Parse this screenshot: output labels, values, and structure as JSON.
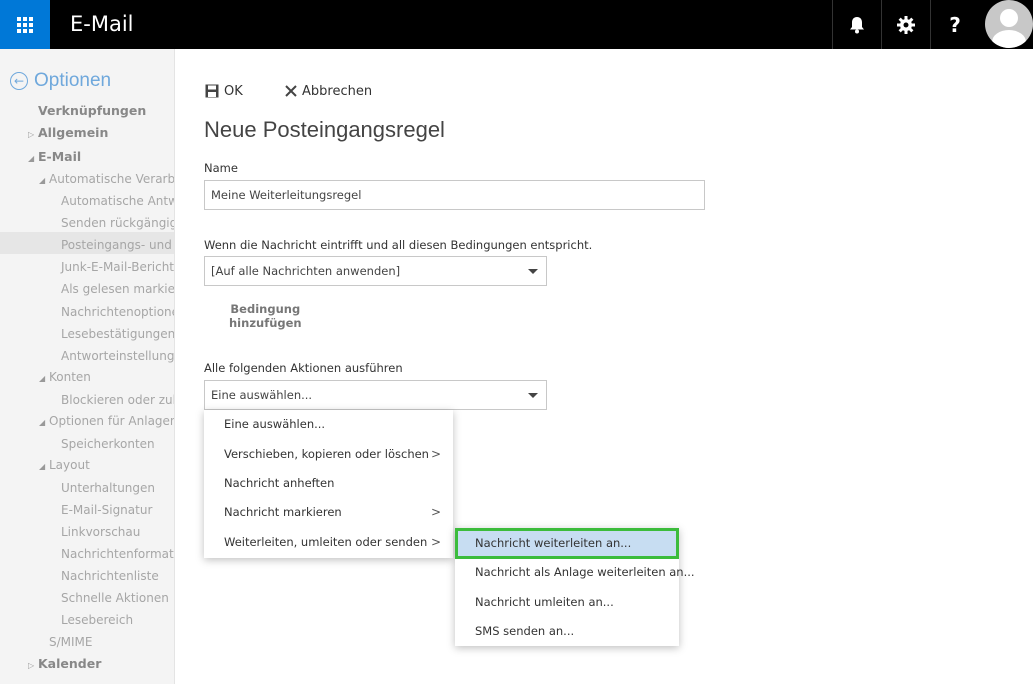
{
  "header": {
    "app_title": "E-Mail"
  },
  "sidebar": {
    "back_label": "Optionen",
    "items": [
      "Verknüpfungen",
      "Allgemein",
      "E-Mail",
      "Automatische Verarbeitung",
      "Automatische Antworten",
      "Senden rückgängig machen",
      "Posteingangs- und Aufräumregeln",
      "Junk-E-Mail-Berichterstattung",
      "Als gelesen markieren",
      "Nachrichtenoptionen",
      "Lesebestätigungen",
      "Antworteinstellungen",
      "Konten",
      "Blockieren oder zulassen",
      "Optionen für Anlagen",
      "Speicherkonten",
      "Layout",
      "Unterhaltungen",
      "E-Mail-Signatur",
      "Linkvorschau",
      "Nachrichtenformat",
      "Nachrichtenliste",
      "Schnelle Aktionen",
      "Lesebereich",
      "S/MIME",
      "Kalender"
    ]
  },
  "toolbar": {
    "ok_label": "OK",
    "cancel_label": "Abbrechen"
  },
  "form": {
    "title": "Neue Posteingangsregel",
    "name_label": "Name",
    "name_value": "Meine Weiterleitungsregel",
    "condition_label": "Wenn die Nachricht eintrifft und all diesen Bedingungen entspricht.",
    "condition_value": "[Auf alle Nachrichten anwenden]",
    "add_condition_line1": "Bedingung",
    "add_condition_line2": "hinzufügen",
    "actions_label": "Alle folgenden Aktionen ausführen",
    "actions_value": "Eine auswählen..."
  },
  "menu1": {
    "items": [
      "Eine auswählen...",
      "Verschieben, kopieren oder löschen",
      "Nachricht anheften",
      "Nachricht markieren",
      "Weiterleiten, umleiten oder senden"
    ]
  },
  "menu2": {
    "items": [
      "Nachricht weiterleiten an...",
      "Nachricht als Anlage weiterleiten an...",
      "Nachricht umleiten an...",
      "SMS senden an..."
    ]
  },
  "colors": {
    "brand": "#0078d7",
    "highlight": "#c7ddf2",
    "focus_outline": "#3cbc3c"
  }
}
